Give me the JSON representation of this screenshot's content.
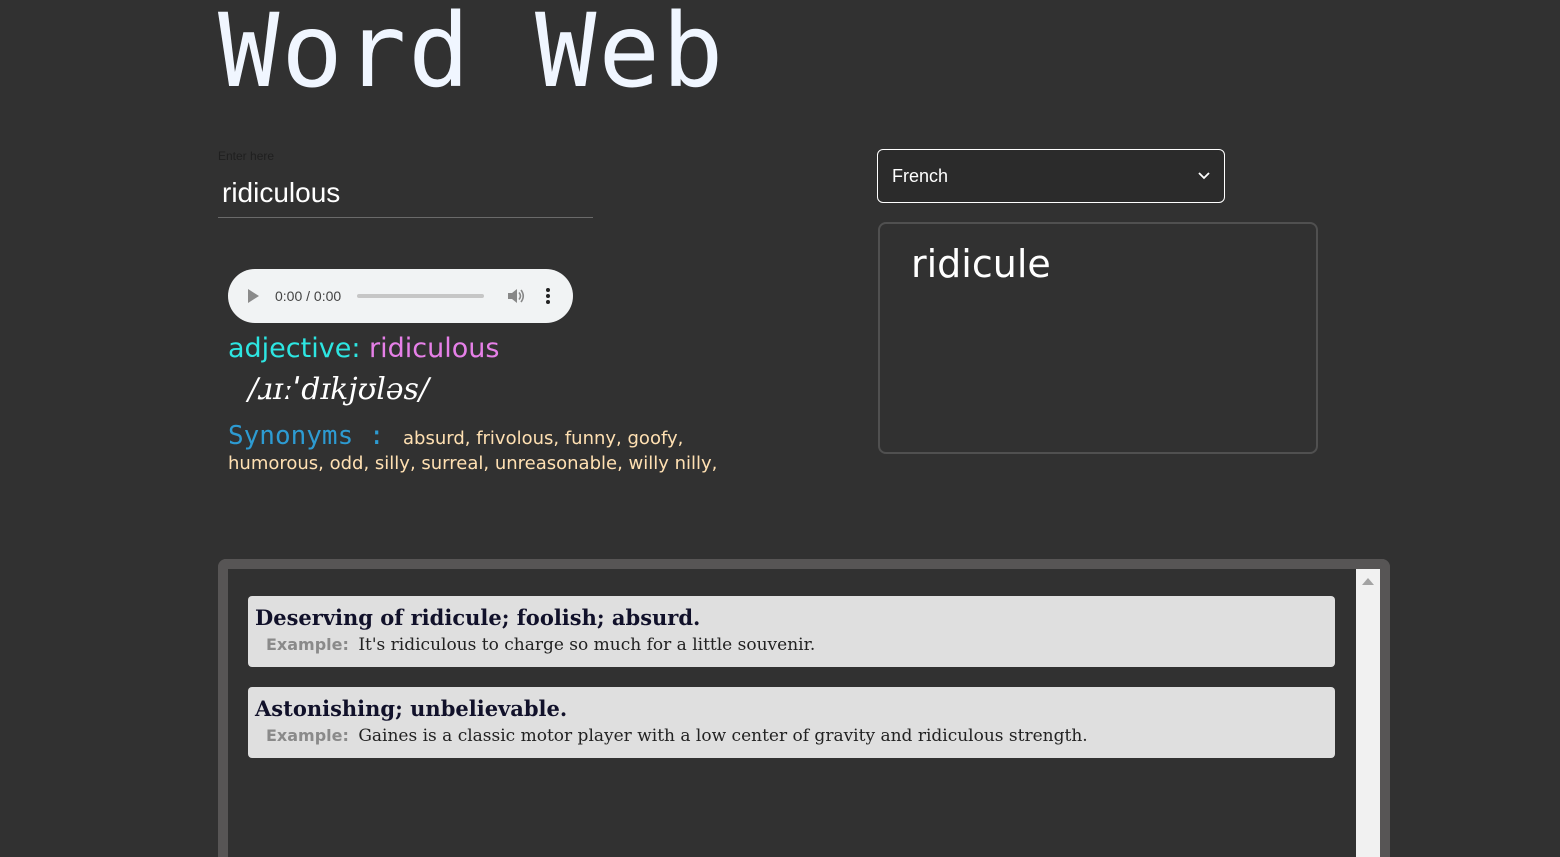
{
  "app": {
    "title": "Word Web"
  },
  "search": {
    "label": "Enter here",
    "value": "ridiculous"
  },
  "audio": {
    "time": "0:00 / 0:00",
    "progress": 0
  },
  "word_info": {
    "pos_label": "adjective:",
    "pos_word": "ridiculous",
    "phonetic": "/ɹɪːˈdɪkjʊləs/",
    "synonyms_label": "Synonyms :",
    "synonyms": "absurd, frivolous, funny, goofy, humorous, odd, silly, surreal, unreasonable, willy nilly,"
  },
  "translation": {
    "language": "French",
    "result": "ridicule"
  },
  "definitions": {
    "example_label": "Example:",
    "items": [
      {
        "definition": "Deserving of ridicule; foolish; absurd.",
        "example": "It's ridiculous to charge so much for a little souvenir."
      },
      {
        "definition": "Astonishing; unbelievable.",
        "example": "Gaines is a classic motor player with a low center of gravity and ridiculous strength."
      }
    ]
  },
  "colors": {
    "background": "#313131",
    "pos_label": "#2de6e2",
    "pos_word": "#e680e8",
    "synonyms_label": "#2d9bd2",
    "synonyms_text": "#ffe0b2",
    "card_bg": "#dfdfdf"
  }
}
